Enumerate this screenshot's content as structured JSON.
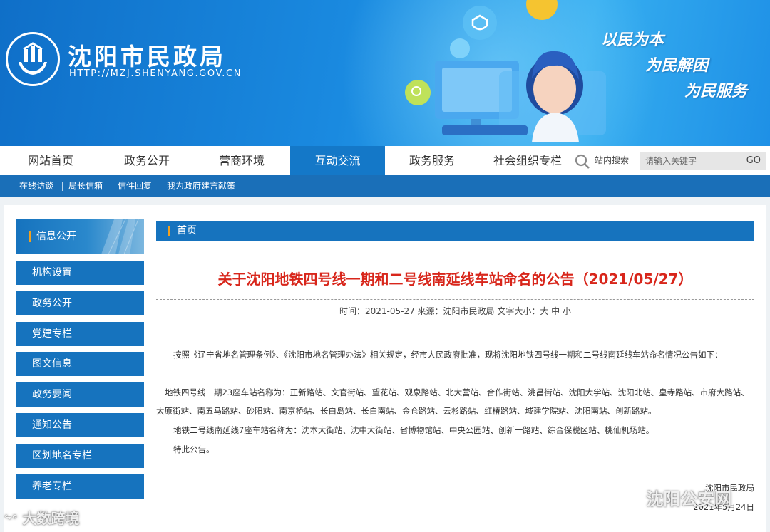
{
  "header": {
    "site_title": "沈阳市民政局",
    "site_url": "HTTP://MZJ.SHENYANG.GOV.CN",
    "slogans": [
      "以民为本",
      "为民解困",
      "为民服务"
    ]
  },
  "main_nav": {
    "items": [
      {
        "label": "网站首页"
      },
      {
        "label": "政务公开"
      },
      {
        "label": "营商环境"
      },
      {
        "label": "互动交流"
      },
      {
        "label": "政务服务"
      },
      {
        "label": "社会组织专栏"
      }
    ],
    "active_index": 3,
    "search_label": "站内搜索",
    "search_placeholder": "请输入关键字",
    "search_go": "GO"
  },
  "sub_nav": {
    "items": [
      {
        "label": "在线访谈"
      },
      {
        "label": "局长信箱"
      },
      {
        "label": "信件回复"
      },
      {
        "label": "我为政府建言献策"
      }
    ]
  },
  "sidebar": {
    "heading": "信息公开",
    "items": [
      {
        "label": "机构设置"
      },
      {
        "label": "政务公开"
      },
      {
        "label": "党建专栏"
      },
      {
        "label": "图文信息"
      },
      {
        "label": "政务要闻"
      },
      {
        "label": "通知公告"
      },
      {
        "label": "区划地名专栏"
      },
      {
        "label": "养老专栏"
      }
    ]
  },
  "breadcrumb": {
    "label": "首页"
  },
  "article": {
    "title": "关于沈阳地铁四号线一期和二号线南延线车站命名的公告（2021/05/27）",
    "meta": "时间：2021-05-27 来源：沈阳市民政局 文字大小：大  中  小",
    "paragraphs": [
      "按照《辽宁省地名管理条例》、《沈阳市地名管理办法》相关规定，经市人民政府批准，现将沈阳地铁四号线一期和二号线南延线车站命名情况公告如下：",
      "地铁四号线一期23座车站名称为：正新路站、文官街站、望花站、观泉路站、北大营站、合作街站、洮昌街站、沈阳大学站、沈阳北站、皇寺路站、市府大路站、太原街站、南五马路站、砂阳站、南京桥站、长白岛站、长白南站、金仓路站、云杉路站、红椿路站、城建学院站、沈阳南站、创新路站。",
      "地铁二号线南延线7座车站名称为：沈本大街站、沈中大街站、省博物馆站、中央公园站、创新一路站、综合保税区站、桃仙机场站。",
      "特此公告。"
    ],
    "signature": "沈阳市民政局",
    "signature_date": "2021年5月24日"
  },
  "watermarks": {
    "left": "大数跨境",
    "right": "沈阳公安网"
  },
  "colors": {
    "nav_blue": "#1673be",
    "title_red": "#d8261b",
    "accent_orange": "#f0a020"
  }
}
